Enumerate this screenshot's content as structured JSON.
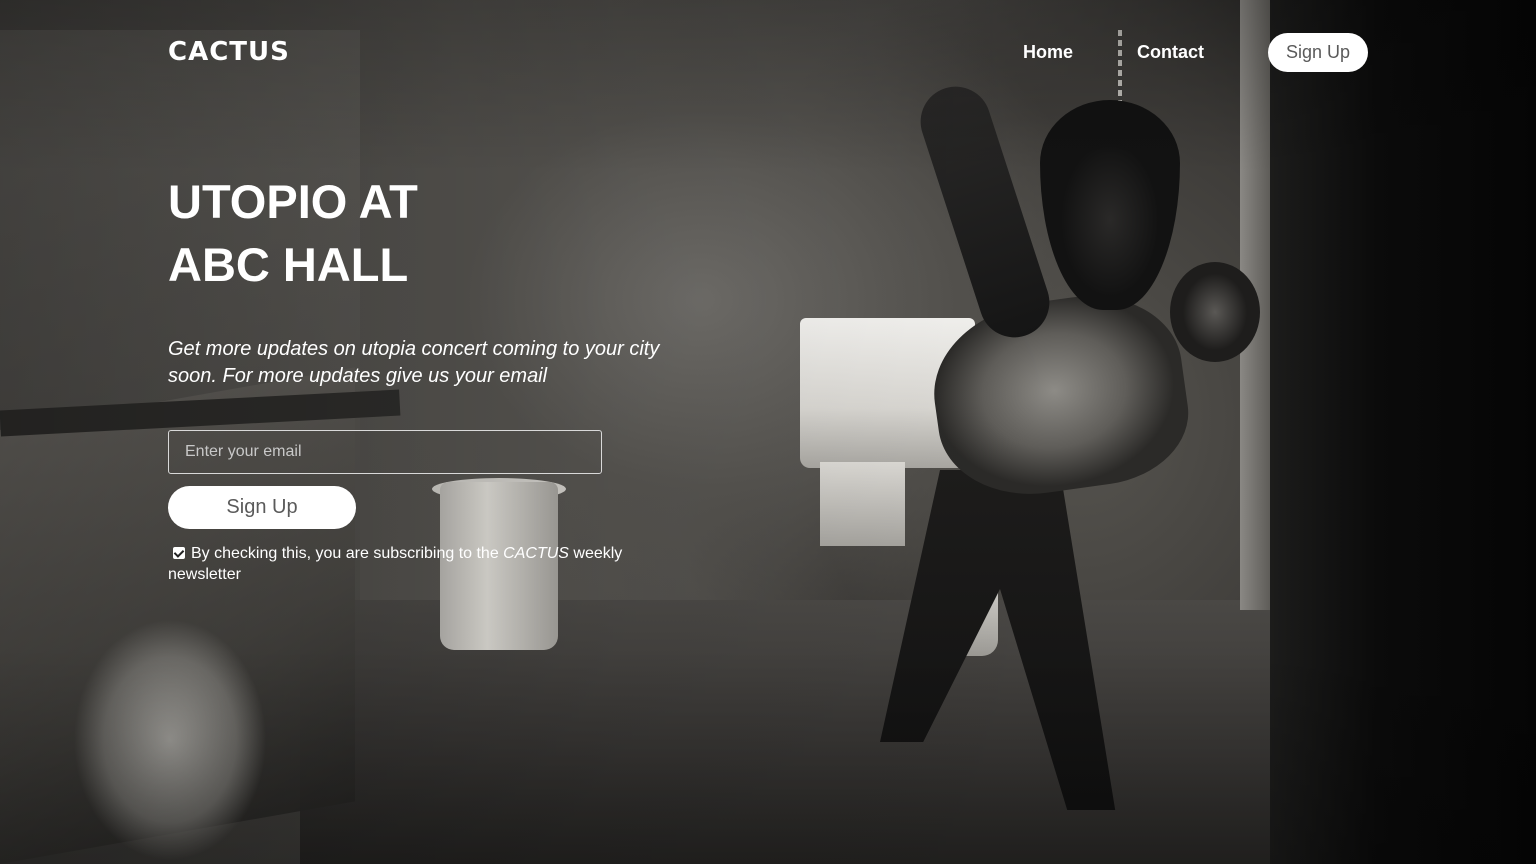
{
  "nav": {
    "logo": "CACTUS",
    "links": [
      "Home",
      "Contact"
    ],
    "signup_label": "Sign Up"
  },
  "hero": {
    "title_line1": "UTOPIO AT",
    "title_line2": "ABC HALL",
    "subtitle": "Get more updates on utopia concert coming to your city soon. For more updates give us your email",
    "email_placeholder": "Enter your email",
    "email_value": "",
    "signup_label": "Sign Up",
    "consent": {
      "checked": true,
      "text_before": "By checking this, you are subscribing to the ",
      "brand": "CACTUS",
      "text_after": " weekly newsletter"
    }
  },
  "colors": {
    "text": "#ffffff",
    "button_bg": "#ffffff",
    "button_text": "#5a5a5a"
  }
}
